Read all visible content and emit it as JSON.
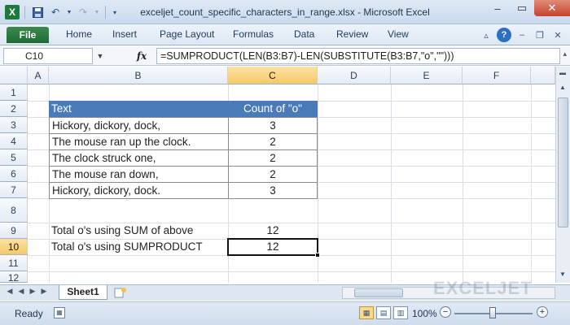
{
  "window": {
    "title": "exceljet_count_specific_characters_in_range.xlsx - Microsoft Excel"
  },
  "ribbon": {
    "tabs": [
      "File",
      "Home",
      "Insert",
      "Page Layout",
      "Formulas",
      "Data",
      "Review",
      "View"
    ]
  },
  "formula_bar": {
    "name_box": "C10",
    "fx": "fx",
    "formula": "=SUMPRODUCT(LEN(B3:B7)-LEN(SUBSTITUTE(B3:B7,\"o\",\"\")))"
  },
  "grid": {
    "columns": [
      "A",
      "B",
      "C",
      "D",
      "E",
      "F"
    ],
    "rows": [
      "1",
      "2",
      "3",
      "4",
      "5",
      "6",
      "7",
      "8",
      "9",
      "10",
      "11",
      "12"
    ],
    "selected_column": "C",
    "selected_row": "10",
    "table": {
      "headers": [
        "Text",
        "Count of \"o\""
      ],
      "rows": [
        {
          "text": "Hickory, dickory, dock,",
          "count": "3"
        },
        {
          "text": "The mouse ran up the clock.",
          "count": "2"
        },
        {
          "text": "The clock struck one,",
          "count": "2"
        },
        {
          "text": "The mouse ran down,",
          "count": "2"
        },
        {
          "text": "Hickory, dickory, dock.",
          "count": "3"
        }
      ]
    },
    "totals": [
      {
        "label": "Total o's using SUM of above",
        "value": "12"
      },
      {
        "label": "Total o's using SUMPRODUCT",
        "value": "12"
      }
    ]
  },
  "sheets": {
    "active": "Sheet1"
  },
  "watermark": "EXCELJET",
  "status": {
    "ready": "Ready",
    "zoom": "100%"
  }
}
